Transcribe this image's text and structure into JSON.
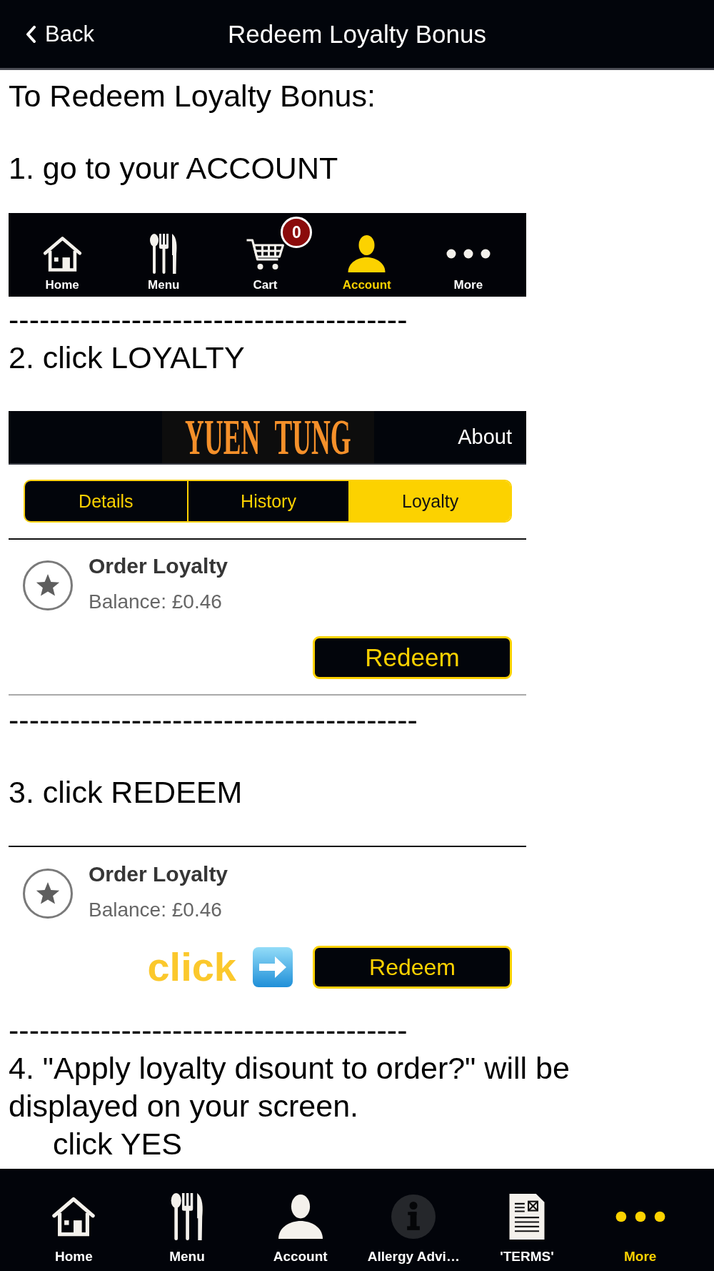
{
  "header": {
    "back": "Back",
    "title": "Redeem Loyalty Bonus"
  },
  "content": [
    {
      "kind": "heading",
      "text": "To Redeem Loyalty Bonus:"
    },
    {
      "kind": "step",
      "text": "1. go to your ACCOUNT"
    },
    {
      "kind": "nav_screenshot",
      "items": [
        {
          "label": "Home",
          "selected": false
        },
        {
          "label": "Menu",
          "selected": false
        },
        {
          "label": "Cart",
          "selected": false,
          "badge": "0"
        },
        {
          "label": "Account",
          "selected": true
        },
        {
          "label": "More",
          "selected": false
        }
      ]
    },
    {
      "kind": "separator",
      "text": "---------------------------------------"
    },
    {
      "kind": "step",
      "text": "2. click LOYALTY"
    },
    {
      "kind": "account_screenshot",
      "logo": "YUEN TUNG",
      "link": "About",
      "tabs": [
        {
          "label": "Details",
          "selected": false
        },
        {
          "label": "History",
          "selected": false
        },
        {
          "label": "Loyalty",
          "selected": true
        }
      ],
      "card": {
        "title": "Order Loyalty",
        "balance": "Balance: £0.46",
        "button": "Redeem"
      }
    },
    {
      "kind": "separator",
      "text": "----------------------------------------"
    },
    {
      "kind": "step",
      "text": "3. click REDEEM"
    },
    {
      "kind": "redeem_screenshot",
      "card": {
        "title": "Order Loyalty",
        "balance": "Balance: £0.46",
        "hint": "click",
        "button": "Redeem"
      }
    },
    {
      "kind": "separator",
      "text": "---------------------------------------"
    },
    {
      "kind": "step",
      "text": "4. \"Apply loyalty disount to order?\" will be displayed on your screen."
    },
    {
      "kind": "note",
      "text": "click YES"
    }
  ],
  "tab_bar": {
    "items": [
      {
        "label": "Home",
        "selected": false
      },
      {
        "label": "Menu",
        "selected": false
      },
      {
        "label": "Account",
        "selected": false
      },
      {
        "label": "Allergy Advi…",
        "selected": false
      },
      {
        "label": "'TERMS'",
        "selected": false
      },
      {
        "label": "More",
        "selected": true
      }
    ]
  }
}
